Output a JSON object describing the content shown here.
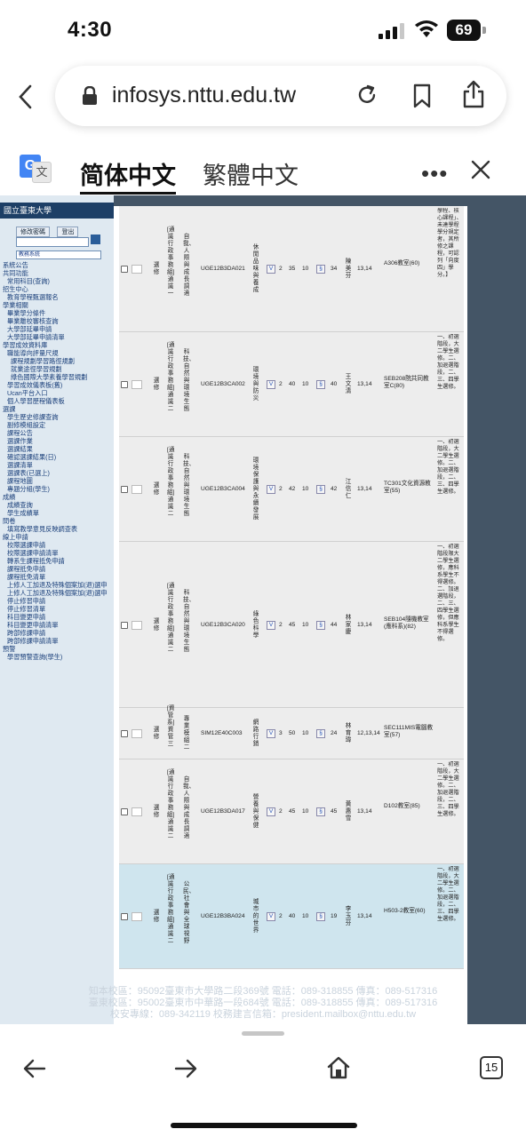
{
  "status": {
    "time": "4:30",
    "battery": "69"
  },
  "browser": {
    "url": "infosys.nttu.edu.tw"
  },
  "translate": {
    "simplified": "简体中文",
    "traditional": "繁體中文",
    "more": "•••"
  },
  "sidebar": {
    "logo": "國立臺東大學",
    "btn_change_pw": "修改密碼",
    "btn_logout": "登出",
    "select_value": "教務系統",
    "items": [
      {
        "label": "系統公告",
        "level": 1
      },
      {
        "label": "共同功能",
        "level": 1
      },
      {
        "label": "常用科目(查詢)",
        "level": 2
      },
      {
        "label": "招生中心",
        "level": 1
      },
      {
        "label": "教育學程甄選報名",
        "level": 2
      },
      {
        "label": "學業相關",
        "level": 1
      },
      {
        "label": "畢業學分條件",
        "level": 2
      },
      {
        "label": "畢業離校審核查詢",
        "level": 2
      },
      {
        "label": "大學部延畢申請",
        "level": 2
      },
      {
        "label": "大學部延畢申請清單",
        "level": 2
      },
      {
        "label": "學習成效資料庫",
        "level": 1
      },
      {
        "label": "職能導向評量尺規",
        "level": 2
      },
      {
        "label": "課程規劃學習路徑規劃",
        "level": 3
      },
      {
        "label": "就業途徑學習規劃",
        "level": 3
      },
      {
        "label": "綠色國際大學素養學習規劃",
        "level": 3
      },
      {
        "label": "學習成效儀表板(舊)",
        "level": 2
      },
      {
        "label": "Ucan平台入口",
        "level": 2
      },
      {
        "label": "個人學習歷程儀表板",
        "level": 2
      },
      {
        "label": "選課",
        "level": 1
      },
      {
        "label": "學生歷史修課查詢",
        "level": 2
      },
      {
        "label": "副修模組設定",
        "level": 2
      },
      {
        "label": "課程公告",
        "level": 2
      },
      {
        "label": "選課作業",
        "level": 2
      },
      {
        "label": "選課結果",
        "level": 2
      },
      {
        "label": "確認選課結果(日)",
        "level": 2
      },
      {
        "label": "選課清單",
        "level": 2
      },
      {
        "label": "選課表(已選上)",
        "level": 2
      },
      {
        "label": "課程地圖",
        "level": 2
      },
      {
        "label": "專題分組(學生)",
        "level": 2
      },
      {
        "label": "成績",
        "level": 1
      },
      {
        "label": "成績查詢",
        "level": 2
      },
      {
        "label": "學生成績單",
        "level": 2
      },
      {
        "label": "問卷",
        "level": 1
      },
      {
        "label": "填寫教學意見反映調查表",
        "level": 2
      },
      {
        "label": "線上申請",
        "level": 1
      },
      {
        "label": "校際選課申請",
        "level": 2
      },
      {
        "label": "校際選課申請清單",
        "level": 2
      },
      {
        "label": "轉系生課程抵免申請",
        "level": 2
      },
      {
        "label": "課程抵免申請",
        "level": 2
      },
      {
        "label": "課程抵免清單",
        "level": 2
      },
      {
        "label": "上修人工加退及特殊個案加(退)選申",
        "level": 2
      },
      {
        "label": "上修人工加退及特殊個案加(退)選申",
        "level": 2
      },
      {
        "label": "停止修習申請",
        "level": 2
      },
      {
        "label": "停止修習清單",
        "level": 2
      },
      {
        "label": "科目變更申請",
        "level": 2
      },
      {
        "label": "科目變更申請清單",
        "level": 2
      },
      {
        "label": "跨部修課申請",
        "level": 2
      },
      {
        "label": "跨部修課申請清單",
        "level": 2
      },
      {
        "label": "預警",
        "level": 1
      },
      {
        "label": "學習預警查詢(學生)",
        "level": 2
      }
    ]
  },
  "courses": [
    {
      "type": "選修",
      "category": "[通識行政事務組]通識一",
      "field": "自我、人際與成長調適",
      "code": "UGE12B3DA021",
      "name": "休閒品味與養成",
      "credits": "2",
      "limit": "35",
      "min": "10",
      "selected": "34",
      "teacher": "陳美芬",
      "time": "13,14",
      "room": "A306教室(60)",
      "remark": "學程、核心課程」、未達學程學分規定者，其所修之課程，可認列「向度四」學分。】"
    },
    {
      "type": "選修",
      "category": "[通識行政事務組]通識二",
      "field": "科技、自然與環境生態",
      "code": "UGE12B3CA002",
      "name": "環境與防災",
      "credits": "2",
      "limit": "40",
      "min": "10",
      "selected": "40",
      "teacher": "王文清",
      "time": "13,14",
      "room": "SEB208院共同教室C(80)",
      "remark": "一、初選階段，大二學生選修。二、加退選階段，二、三、四學生選修。"
    },
    {
      "type": "選修",
      "category": "[通識行政事務組]通識二",
      "field": "科技、自然與環境生態",
      "code": "UGE12B3CA004",
      "name": "環境保護與永續發展",
      "credits": "2",
      "limit": "42",
      "min": "10",
      "selected": "42",
      "teacher": "江信仁",
      "time": "13,14",
      "room": "TC301文化資源教室(55)",
      "remark": "一、初選階段，大二學生選修。二、加退選階段，二、三、四學生選修。"
    },
    {
      "type": "選修",
      "category": "[通識行政事務組]通識二",
      "field": "科技、自然與環境生態",
      "code": "UGE12B3CA020",
      "name": "綠色科學",
      "credits": "2",
      "limit": "45",
      "min": "10",
      "selected": "44",
      "teacher": "林家慶",
      "time": "13,14",
      "room": "SEB104隨機教室(應科系)(82)",
      "remark": "一、初選階段限大二學生選修，應科系學生不得選修。二、加退選階段，二、三、四學生選修，但應科系學生不得選修。"
    },
    {
      "type": "選修",
      "category": "[資管系]資管三",
      "field": "專業模組二",
      "code": "SIM12E40C003",
      "name": "網路行銷",
      "credits": "3",
      "limit": "50",
      "min": "10",
      "selected": "24",
      "teacher": "林育瑋",
      "time": "12,13,14",
      "room": "SEC111MIS電腦教室(57)",
      "remark": ""
    },
    {
      "type": "選修",
      "category": "[通識行政事務組]通識二",
      "field": "自我、人際與成長調適",
      "code": "UGE12B3DA017",
      "name": "營養與保健",
      "credits": "2",
      "limit": "45",
      "min": "10",
      "selected": "45",
      "teacher": "黃惠雪",
      "time": "13,14",
      "room": "D102教室(85)",
      "remark": "一、初選階段，大二學生選修。二、加退選階段，二、三、四學生選修。"
    },
    {
      "type": "選修",
      "category": "[通識行政事務組]通識二",
      "field": "公民、社會與全球視野",
      "code": "UGE12B3BA024",
      "name": "城市的世界",
      "credits": "2",
      "limit": "40",
      "min": "10",
      "selected": "19",
      "teacher": "李玉芬",
      "time": "13,14",
      "room": "H503-2教室(60)",
      "remark": "一、初選階段，大二學生選修。二、加退選階段，二、三、四學生選修。"
    }
  ],
  "footer": {
    "line1": "知本校區：95092臺東市大學路二段369號 電話：089-318855 傳真：089-517316",
    "line2": "臺東校區：95002臺東市中華路一段684號 電話：089-318855 傳真：089-517316",
    "line3": "校安專線：089-342119 校務建言信箱：president.mailbox@nttu.edu.tw"
  },
  "nav": {
    "tab_count": "15"
  }
}
